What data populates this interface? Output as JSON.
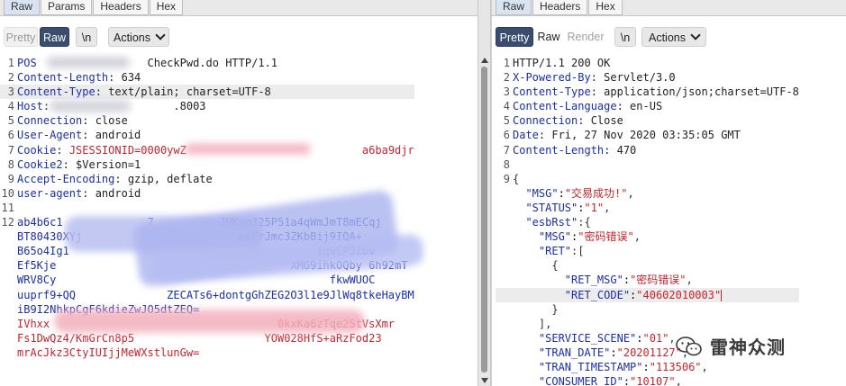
{
  "request": {
    "tabs": [
      "Raw",
      "Params",
      "Headers",
      "Hex"
    ],
    "toolbar": {
      "pretty": "Pretty",
      "raw": "Raw",
      "newline": "\\n",
      "actions": "Actions"
    },
    "lines": [
      {
        "n": "1",
        "key": "POS",
        "sep": "",
        "val": "                 CheckPwd.do HTTP/1.1"
      },
      {
        "n": "2",
        "key": "Content-Length",
        "sep": ": ",
        "val": "634"
      },
      {
        "n": "3",
        "key": "Content-Type",
        "sep": ": ",
        "val": "text/plain; charset=UTF-8"
      },
      {
        "n": "4",
        "key": "Host",
        "sep": ": ",
        "val": "                  .8003"
      },
      {
        "n": "5",
        "key": "Connection",
        "sep": ": ",
        "val": "close"
      },
      {
        "n": "6",
        "key": "User-Agent",
        "sep": ": ",
        "val": "android"
      },
      {
        "n": "7",
        "key": "Cookie",
        "sep": ": ",
        "val": "JSESSIONID=0000ywZ                           a6ba9djr"
      },
      {
        "n": "8",
        "key": "Cookie2",
        "sep": ": ",
        "val": "$Version=1"
      },
      {
        "n": "9",
        "key": "Accept-Encoding",
        "sep": ": ",
        "val": "gzip, deflate"
      },
      {
        "n": "10",
        "key": "user-agent",
        "sep": ": ",
        "val": "android"
      },
      {
        "n": "11",
        "key": "",
        "sep": "",
        "val": ""
      }
    ],
    "body_line_number": "12",
    "body": [
      "ab4b6c1             7          JHKaq325P51a4qWmJmT8mECqj",
      "BT80430XYj                        6KFrJmc3ZKbBij9IQA+",
      "B65o4Ig1                                      iq9EPJ2bv",
      "Ef5Kje                                    XMG9ihkOQby 6h92mT",
      "WRV8Cy                                          fkwWUOC",
      "uuprf9+QQ              ZECATs6+dontgGhZEG2O3l1e9JlWq8tkeHayBM",
      "iB9I2NhkpCgF6kdieZwJO5dtZEQ=",
      "IVhxx                                   0kxKa6zTqe25tVsXmr",
      "Fs1DwQz4/KmGrCn8p5                    YOW028HfS+aRzFod23",
      "mrAcJkz3CtyIUIjjMeWXstlunGw="
    ]
  },
  "response": {
    "tabs": [
      "Raw",
      "Headers",
      "Hex"
    ],
    "toolbar": {
      "pretty": "Pretty",
      "raw": "Raw",
      "render": "Render",
      "newline": "\\n",
      "actions": "Actions"
    },
    "lines": [
      {
        "n": "1",
        "key": "",
        "sep": "",
        "val": "HTTP/1.1 200 OK"
      },
      {
        "n": "2",
        "key": "X-Powered-By",
        "sep": ": ",
        "val": "Servlet/3.0"
      },
      {
        "n": "3",
        "key": "Content-Type",
        "sep": ": ",
        "val": "application/json;charset=UTF-8"
      },
      {
        "n": "4",
        "key": "Content-Language",
        "sep": ": ",
        "val": "en-US"
      },
      {
        "n": "5",
        "key": "Connection",
        "sep": ": ",
        "val": "Close"
      },
      {
        "n": "6",
        "key": "Date",
        "sep": ": ",
        "val": "Fri, 27 Nov 2020 03:35:05 GMT"
      },
      {
        "n": "7",
        "key": "Content-Length",
        "sep": ": ",
        "val": "470"
      },
      {
        "n": "8",
        "key": "",
        "sep": "",
        "val": ""
      }
    ],
    "json_line_number": "9",
    "json": [
      {
        "indent": "",
        "key": "",
        "val": "",
        "punct": "{"
      },
      {
        "indent": "  ",
        "key": "\"MSG\"",
        "val": "\"交易成功!\"",
        "punct": ","
      },
      {
        "indent": "  ",
        "key": "\"STATUS\"",
        "val": "\"1\"",
        "punct": ","
      },
      {
        "indent": "  ",
        "key": "\"esbRst\"",
        "val": "",
        "punct": ":{"
      },
      {
        "indent": "    ",
        "key": "\"MSG\"",
        "val": "\"密码错误\"",
        "punct": ","
      },
      {
        "indent": "    ",
        "key": "\"RET\"",
        "val": "",
        "punct": ":["
      },
      {
        "indent": "      ",
        "key": "",
        "val": "",
        "punct": "{"
      },
      {
        "indent": "        ",
        "key": "\"RET_MSG\"",
        "val": "\"密码错误\"",
        "punct": ","
      },
      {
        "indent": "        ",
        "key": "\"RET_CODE\"",
        "val": "\"40602010003\"",
        "punct": ""
      },
      {
        "indent": "      ",
        "key": "",
        "val": "",
        "punct": "}"
      },
      {
        "indent": "    ",
        "key": "",
        "val": "",
        "punct": "],"
      },
      {
        "indent": "    ",
        "key": "\"SERVICE_SCENE\"",
        "val": "\"01\"",
        "punct": ","
      },
      {
        "indent": "    ",
        "key": "\"TRAN_DATE\"",
        "val": "\"20201127\"",
        "punct": ","
      },
      {
        "indent": "    ",
        "key": "\"TRAN_TIMESTAMP\"",
        "val": "\"113506\"",
        "punct": ","
      },
      {
        "indent": "    ",
        "key": "\"CONSUMER_ID\"",
        "val": "\"10107\"",
        "punct": ","
      }
    ]
  },
  "watermark": {
    "text": "雷神众测",
    "icon": "wechat-icon"
  }
}
